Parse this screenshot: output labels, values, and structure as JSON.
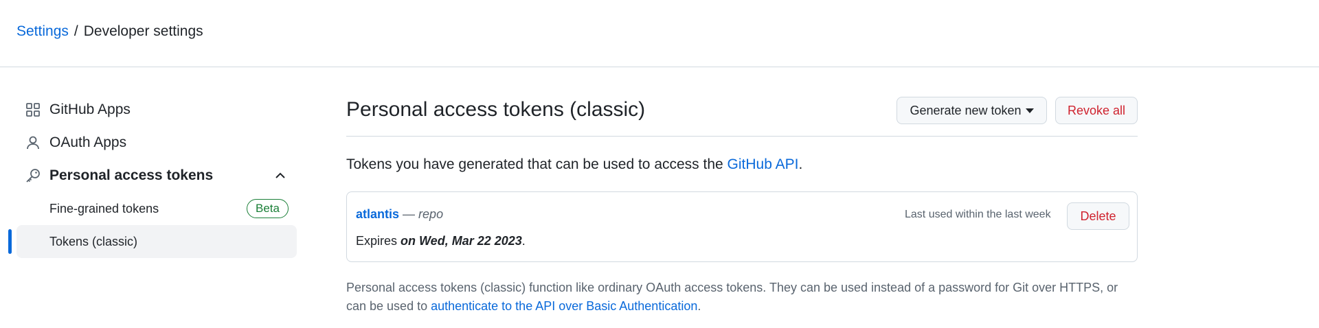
{
  "breadcrumb": {
    "settings": "Settings",
    "separator": "/",
    "current": "Developer settings"
  },
  "sidebar": {
    "items": [
      {
        "label": "GitHub Apps",
        "icon": "apps-grid-icon"
      },
      {
        "label": "OAuth Apps",
        "icon": "person-icon"
      },
      {
        "label": "Personal access tokens",
        "icon": "key-icon"
      }
    ],
    "sub_items": [
      {
        "label": "Fine-grained tokens",
        "badge": "Beta"
      },
      {
        "label": "Tokens (classic)",
        "active": true
      }
    ]
  },
  "main": {
    "title": "Personal access tokens (classic)",
    "generate_label": "Generate new token",
    "revoke_label": "Revoke all",
    "intro_prefix": "Tokens you have generated that can be used to access the ",
    "intro_link": "GitHub API",
    "intro_suffix": "."
  },
  "token": {
    "name": "atlantis",
    "dash": " — ",
    "scope": "repo",
    "last_used": "Last used within the last week",
    "delete_label": "Delete",
    "expires_prefix": "Expires ",
    "expires_date": "on Wed, Mar 22 2023",
    "expires_suffix": "."
  },
  "note": {
    "text": "Personal access tokens (classic) function like ordinary OAuth access tokens. They can be used instead of a password for Git over HTTPS, or can be used to ",
    "link": "authenticate to the API over Basic Authentication",
    "suffix": "."
  },
  "colors": {
    "link": "#0969da",
    "danger": "#cf222e",
    "success": "#1a7f37",
    "border": "#d1d9e0"
  }
}
